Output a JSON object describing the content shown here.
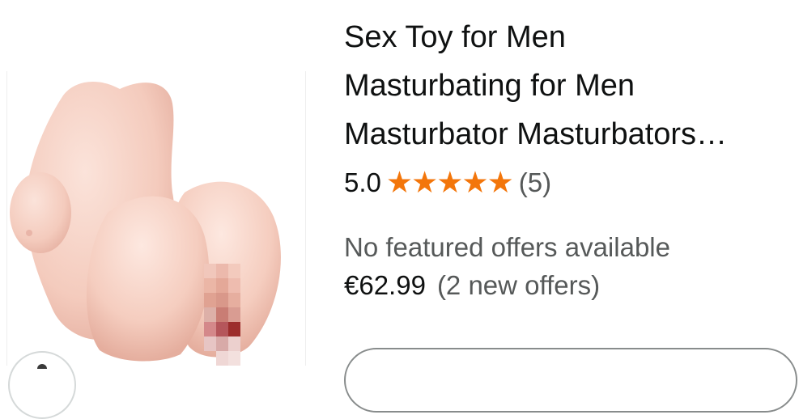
{
  "product": {
    "title_lines": [
      "Sex Toy for Men",
      "Masturbating for Men",
      "Masturbator Masturbators…"
    ],
    "rating": {
      "value": "5.0",
      "stars": 5,
      "star_glyph": "★",
      "count": "(5)",
      "star_color": "#f3760b"
    },
    "offer_status": "No featured offers available",
    "price": "€62.99",
    "offers_text": "(2 new offers)",
    "image": {
      "kind": "product-photo-pixelated"
    }
  },
  "colors": {
    "text_primary": "#0f1111",
    "text_secondary": "#565959",
    "star": "#f3760b",
    "skin": "#f6d1c5"
  }
}
